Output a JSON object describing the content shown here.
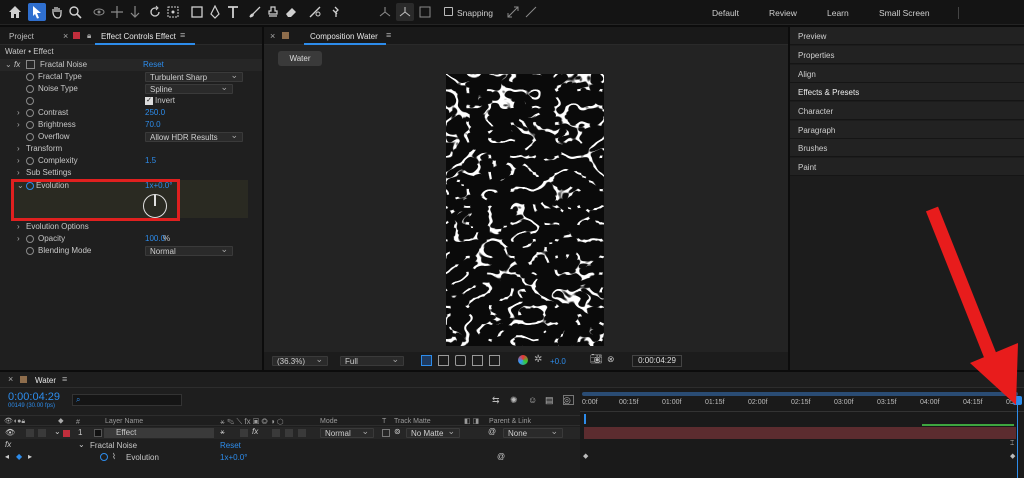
{
  "workspaces": [
    "Default",
    "Review",
    "Learn",
    "Small Screen"
  ],
  "toolbar": {
    "snapping_label": "Snapping"
  },
  "project_tab": "Project",
  "effect_controls": {
    "tab": "Effect Controls Effect",
    "breadcrumb": "Water • Effect",
    "effect_name": "Fractal Noise",
    "reset": "Reset",
    "fractal_type": {
      "label": "Fractal Type",
      "value": "Turbulent Sharp"
    },
    "noise_type": {
      "label": "Noise Type",
      "value": "Spline"
    },
    "invert": "Invert",
    "contrast": {
      "label": "Contrast",
      "value": "250.0"
    },
    "brightness": {
      "label": "Brightness",
      "value": "70.0"
    },
    "overflow": {
      "label": "Overflow",
      "value": "Allow HDR Results"
    },
    "transform": "Transform",
    "complexity": {
      "label": "Complexity",
      "value": "1.5"
    },
    "sub_settings": "Sub Settings",
    "evolution": {
      "label": "Evolution",
      "value": "1x+0.0°"
    },
    "evolution_options": "Evolution Options",
    "opacity": {
      "label": "Opacity",
      "value": "100.0",
      "unit": "%"
    },
    "blending_mode": {
      "label": "Blending Mode",
      "value": "Normal"
    }
  },
  "composition": {
    "tab": "Composition Water",
    "chip": "Water",
    "zoom": "(36.3%)",
    "resolution": "Full",
    "exposure": "+0.0",
    "timecode": "0:00:04:29"
  },
  "right_panel": [
    "Preview",
    "Properties",
    "Align",
    "Effects & Presets",
    "Character",
    "Paragraph",
    "Brushes",
    "Paint"
  ],
  "timeline": {
    "tab": "Water",
    "timecode": "0:00:04:29",
    "frame_info": "00149 (30.00 fps)",
    "search_placeholder": "",
    "col_layer_name": "Layer Name",
    "col_mode": "Mode",
    "col_t": "T",
    "col_track_matte": "Track Matte",
    "col_parent": "Parent & Link",
    "layer": {
      "index": "1",
      "name": "Effect",
      "mode": "Normal",
      "matte": "No Matte",
      "parent": "None"
    },
    "effect_row": {
      "name": "Fractal Noise",
      "reset": "Reset"
    },
    "evolution_row": {
      "name": "Evolution",
      "value": "1x+0.0°"
    },
    "ruler": [
      "0:00f",
      "00:15f",
      "01:00f",
      "01:15f",
      "02:00f",
      "02:15f",
      "03:00f",
      "03:15f",
      "04:00f",
      "04:15f",
      "05:0"
    ]
  },
  "colors": {
    "accent": "#2d8ceb",
    "highlight_box": "#e0201f",
    "arrow": "#e81c1c",
    "layer_bar": "#5c2c2f"
  }
}
